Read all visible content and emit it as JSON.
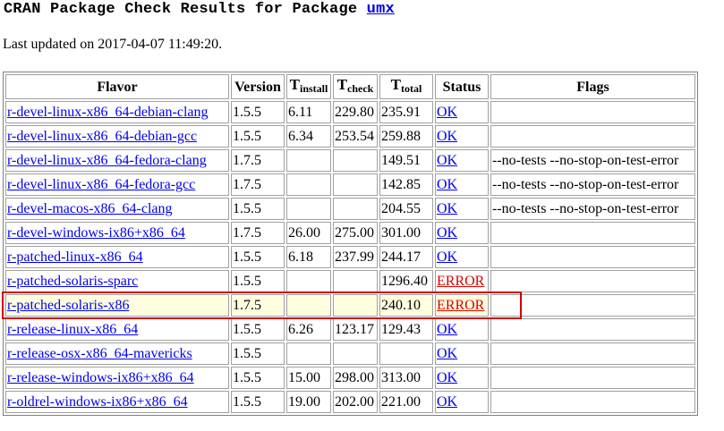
{
  "header": {
    "title_prefix": "CRAN Package Check Results for Package",
    "package": "umx",
    "last_updated": "Last updated on 2017-04-07 11:49:20."
  },
  "table": {
    "columns": {
      "flavor": "Flavor",
      "version": "Version",
      "tinstall_main": "T",
      "tinstall_sub": "install",
      "tcheck_main": "T",
      "tcheck_sub": "check",
      "ttotal_main": "T",
      "ttotal_sub": "total",
      "status": "Status",
      "flags": "Flags"
    },
    "rows": [
      {
        "flavor": "r-devel-linux-x86_64-debian-clang",
        "version": "1.5.5",
        "tinstall": "6.11",
        "tcheck": "229.80",
        "ttotal": "235.91",
        "status": "OK",
        "flags": ""
      },
      {
        "flavor": "r-devel-linux-x86_64-debian-gcc",
        "version": "1.5.5",
        "tinstall": "6.34",
        "tcheck": "253.54",
        "ttotal": "259.88",
        "status": "OK",
        "flags": ""
      },
      {
        "flavor": "r-devel-linux-x86_64-fedora-clang",
        "version": "1.7.5",
        "tinstall": "",
        "tcheck": "",
        "ttotal": "149.51",
        "status": "OK",
        "flags": "--no-tests --no-stop-on-test-error"
      },
      {
        "flavor": "r-devel-linux-x86_64-fedora-gcc",
        "version": "1.7.5",
        "tinstall": "",
        "tcheck": "",
        "ttotal": "142.85",
        "status": "OK",
        "flags": "--no-tests --no-stop-on-test-error"
      },
      {
        "flavor": "r-devel-macos-x86_64-clang",
        "version": "1.5.5",
        "tinstall": "",
        "tcheck": "",
        "ttotal": "204.55",
        "status": "OK",
        "flags": "--no-tests --no-stop-on-test-error"
      },
      {
        "flavor": "r-devel-windows-ix86+x86_64",
        "version": "1.7.5",
        "tinstall": "26.00",
        "tcheck": "275.00",
        "ttotal": "301.00",
        "status": "OK",
        "flags": ""
      },
      {
        "flavor": "r-patched-linux-x86_64",
        "version": "1.5.5",
        "tinstall": "6.18",
        "tcheck": "237.99",
        "ttotal": "244.17",
        "status": "OK",
        "flags": ""
      },
      {
        "flavor": "r-patched-solaris-sparc",
        "version": "1.5.5",
        "tinstall": "",
        "tcheck": "",
        "ttotal": "1296.40",
        "status": "ERROR",
        "flags": ""
      },
      {
        "flavor": "r-patched-solaris-x86",
        "version": "1.7.5",
        "tinstall": "",
        "tcheck": "",
        "ttotal": "240.10",
        "status": "ERROR",
        "flags": ""
      },
      {
        "flavor": "r-release-linux-x86_64",
        "version": "1.5.5",
        "tinstall": "6.26",
        "tcheck": "123.17",
        "ttotal": "129.43",
        "status": "OK",
        "flags": ""
      },
      {
        "flavor": "r-release-osx-x86_64-mavericks",
        "version": "1.5.5",
        "tinstall": "",
        "tcheck": "",
        "ttotal": "",
        "status": "OK",
        "flags": ""
      },
      {
        "flavor": "r-release-windows-ix86+x86_64",
        "version": "1.5.5",
        "tinstall": "15.00",
        "tcheck": "298.00",
        "ttotal": "313.00",
        "status": "OK",
        "flags": ""
      },
      {
        "flavor": "r-oldrel-windows-ix86+x86_64",
        "version": "1.5.5",
        "tinstall": "19.00",
        "tcheck": "202.00",
        "ttotal": "221.00",
        "status": "OK",
        "flags": ""
      }
    ],
    "highlighted_row": 8,
    "colors": {
      "link": "#0000ee",
      "error": "#dd0000",
      "highlight_border": "#d00000",
      "highlight_fill": "#ffffe0"
    }
  }
}
